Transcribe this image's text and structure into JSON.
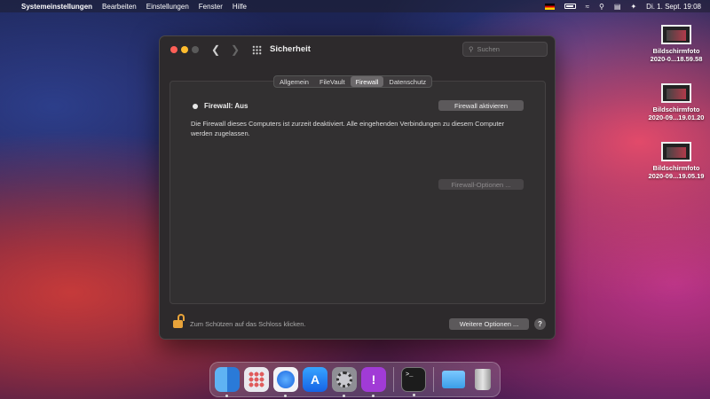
{
  "menubar": {
    "apple_icon": "apple-icon",
    "app_name": "Systemeinstellungen",
    "menus": [
      "Bearbeiten",
      "Einstellungen",
      "Fenster",
      "Hilfe"
    ],
    "clock": "Di. 1. Sept.  19:08"
  },
  "desktop": {
    "items": [
      {
        "line1": "Bildschirmfoto",
        "line2": "2020-0...18.59.58"
      },
      {
        "line1": "Bildschirmfoto",
        "line2": "2020-09...19.01.20"
      },
      {
        "line1": "Bildschirmfoto",
        "line2": "2020-09...19.05.19"
      }
    ]
  },
  "window": {
    "title": "Sicherheit",
    "search_placeholder": "Suchen",
    "tabs": [
      "Allgemein",
      "FileVault",
      "Firewall",
      "Datenschutz"
    ],
    "selected_tab": "Firewall",
    "firewall_status": "Firewall: Aus",
    "activate_button": "Firewall aktivieren",
    "description": "Die Firewall dieses Computers ist zurzeit deaktiviert. Alle eingehenden Verbindungen zu diesem Computer werden zugelassen.",
    "firewall_options_button": "Firewall-Optionen ...",
    "lock_text": "Zum Schützen auf das Schloss klicken.",
    "more_options_button": "Weitere Optionen ...",
    "help_label": "?"
  },
  "dock": {
    "apps": [
      "Finder",
      "Launchpad",
      "Safari",
      "App Store",
      "Systemeinstellungen",
      "Feedback-Assistent",
      "Terminal",
      "Downloads",
      "Papierkorb"
    ]
  },
  "colors": {
    "traffic_red": "#fe5f57",
    "traffic_yellow": "#febc2e",
    "lock_accent": "#e8a33a"
  }
}
